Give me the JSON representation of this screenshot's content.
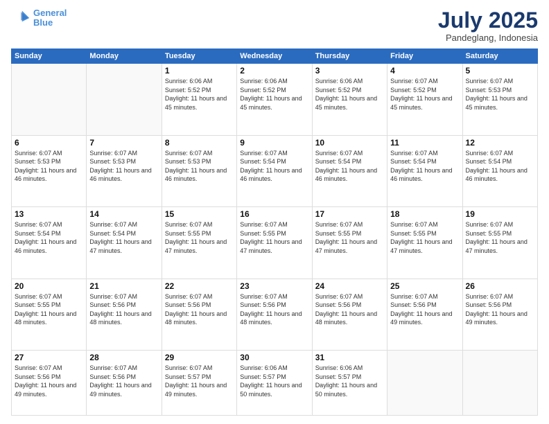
{
  "logo": {
    "line1": "General",
    "line2": "Blue"
  },
  "title": "July 2025",
  "subtitle": "Pandeglang, Indonesia",
  "days_header": [
    "Sunday",
    "Monday",
    "Tuesday",
    "Wednesday",
    "Thursday",
    "Friday",
    "Saturday"
  ],
  "weeks": [
    [
      {
        "day": "",
        "info": ""
      },
      {
        "day": "",
        "info": ""
      },
      {
        "day": "1",
        "info": "Sunrise: 6:06 AM\nSunset: 5:52 PM\nDaylight: 11 hours and 45 minutes."
      },
      {
        "day": "2",
        "info": "Sunrise: 6:06 AM\nSunset: 5:52 PM\nDaylight: 11 hours and 45 minutes."
      },
      {
        "day": "3",
        "info": "Sunrise: 6:06 AM\nSunset: 5:52 PM\nDaylight: 11 hours and 45 minutes."
      },
      {
        "day": "4",
        "info": "Sunrise: 6:07 AM\nSunset: 5:52 PM\nDaylight: 11 hours and 45 minutes."
      },
      {
        "day": "5",
        "info": "Sunrise: 6:07 AM\nSunset: 5:53 PM\nDaylight: 11 hours and 45 minutes."
      }
    ],
    [
      {
        "day": "6",
        "info": "Sunrise: 6:07 AM\nSunset: 5:53 PM\nDaylight: 11 hours and 46 minutes."
      },
      {
        "day": "7",
        "info": "Sunrise: 6:07 AM\nSunset: 5:53 PM\nDaylight: 11 hours and 46 minutes."
      },
      {
        "day": "8",
        "info": "Sunrise: 6:07 AM\nSunset: 5:53 PM\nDaylight: 11 hours and 46 minutes."
      },
      {
        "day": "9",
        "info": "Sunrise: 6:07 AM\nSunset: 5:54 PM\nDaylight: 11 hours and 46 minutes."
      },
      {
        "day": "10",
        "info": "Sunrise: 6:07 AM\nSunset: 5:54 PM\nDaylight: 11 hours and 46 minutes."
      },
      {
        "day": "11",
        "info": "Sunrise: 6:07 AM\nSunset: 5:54 PM\nDaylight: 11 hours and 46 minutes."
      },
      {
        "day": "12",
        "info": "Sunrise: 6:07 AM\nSunset: 5:54 PM\nDaylight: 11 hours and 46 minutes."
      }
    ],
    [
      {
        "day": "13",
        "info": "Sunrise: 6:07 AM\nSunset: 5:54 PM\nDaylight: 11 hours and 46 minutes."
      },
      {
        "day": "14",
        "info": "Sunrise: 6:07 AM\nSunset: 5:54 PM\nDaylight: 11 hours and 47 minutes."
      },
      {
        "day": "15",
        "info": "Sunrise: 6:07 AM\nSunset: 5:55 PM\nDaylight: 11 hours and 47 minutes."
      },
      {
        "day": "16",
        "info": "Sunrise: 6:07 AM\nSunset: 5:55 PM\nDaylight: 11 hours and 47 minutes."
      },
      {
        "day": "17",
        "info": "Sunrise: 6:07 AM\nSunset: 5:55 PM\nDaylight: 11 hours and 47 minutes."
      },
      {
        "day": "18",
        "info": "Sunrise: 6:07 AM\nSunset: 5:55 PM\nDaylight: 11 hours and 47 minutes."
      },
      {
        "day": "19",
        "info": "Sunrise: 6:07 AM\nSunset: 5:55 PM\nDaylight: 11 hours and 47 minutes."
      }
    ],
    [
      {
        "day": "20",
        "info": "Sunrise: 6:07 AM\nSunset: 5:55 PM\nDaylight: 11 hours and 48 minutes."
      },
      {
        "day": "21",
        "info": "Sunrise: 6:07 AM\nSunset: 5:56 PM\nDaylight: 11 hours and 48 minutes."
      },
      {
        "day": "22",
        "info": "Sunrise: 6:07 AM\nSunset: 5:56 PM\nDaylight: 11 hours and 48 minutes."
      },
      {
        "day": "23",
        "info": "Sunrise: 6:07 AM\nSunset: 5:56 PM\nDaylight: 11 hours and 48 minutes."
      },
      {
        "day": "24",
        "info": "Sunrise: 6:07 AM\nSunset: 5:56 PM\nDaylight: 11 hours and 48 minutes."
      },
      {
        "day": "25",
        "info": "Sunrise: 6:07 AM\nSunset: 5:56 PM\nDaylight: 11 hours and 49 minutes."
      },
      {
        "day": "26",
        "info": "Sunrise: 6:07 AM\nSunset: 5:56 PM\nDaylight: 11 hours and 49 minutes."
      }
    ],
    [
      {
        "day": "27",
        "info": "Sunrise: 6:07 AM\nSunset: 5:56 PM\nDaylight: 11 hours and 49 minutes."
      },
      {
        "day": "28",
        "info": "Sunrise: 6:07 AM\nSunset: 5:56 PM\nDaylight: 11 hours and 49 minutes."
      },
      {
        "day": "29",
        "info": "Sunrise: 6:07 AM\nSunset: 5:57 PM\nDaylight: 11 hours and 49 minutes."
      },
      {
        "day": "30",
        "info": "Sunrise: 6:06 AM\nSunset: 5:57 PM\nDaylight: 11 hours and 50 minutes."
      },
      {
        "day": "31",
        "info": "Sunrise: 6:06 AM\nSunset: 5:57 PM\nDaylight: 11 hours and 50 minutes."
      },
      {
        "day": "",
        "info": ""
      },
      {
        "day": "",
        "info": ""
      }
    ]
  ]
}
